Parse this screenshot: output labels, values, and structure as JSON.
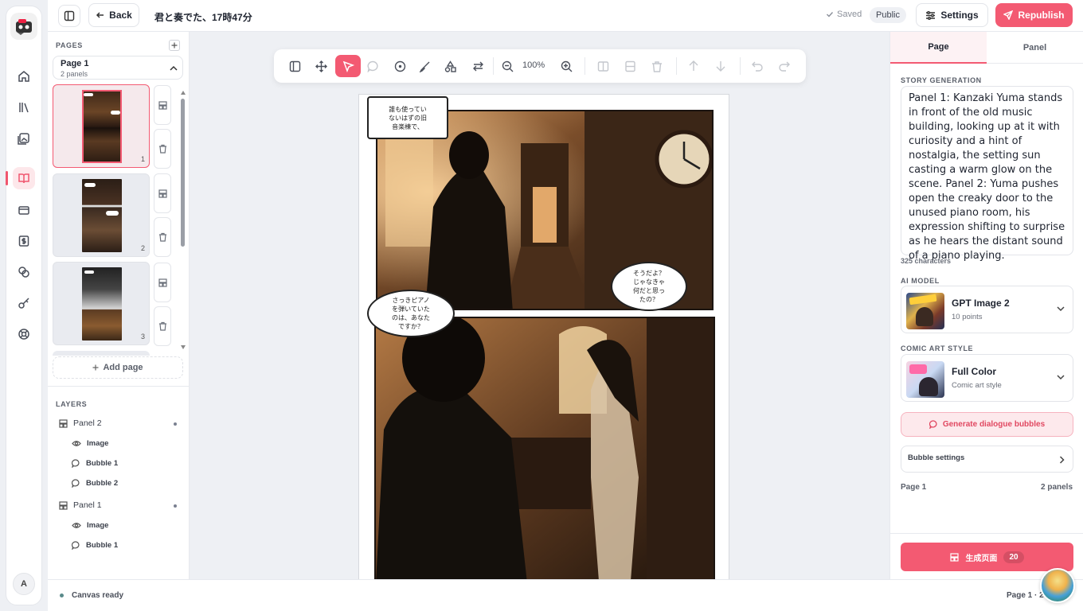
{
  "nav": {
    "items": [
      "home-icon",
      "library-icon",
      "gallery-icon",
      "book-icon",
      "card-icon",
      "dollar-icon",
      "coins-icon",
      "key-icon",
      "help-icon"
    ],
    "active_index": 3,
    "avatar_initial": "A"
  },
  "topbar": {
    "back_label": "Back",
    "doc_title": "君と奏でた、17時47分",
    "saved_label": "Saved",
    "visibility": "Public",
    "settings_label": "Settings",
    "republish_label": "Republish"
  },
  "pages_panel": {
    "heading": "PAGES",
    "current_page": "Page 1",
    "current_page_sub": "2 panels",
    "thumbs": [
      {
        "num": "1"
      },
      {
        "num": "2"
      },
      {
        "num": "3"
      }
    ],
    "add_page_label": "Add page"
  },
  "layers": {
    "heading": "LAYERS",
    "panel2": "Panel 2",
    "panel2_children": [
      "Image",
      "Bubble 1",
      "Bubble 2"
    ],
    "panel1": "Panel 1",
    "panel1_children": [
      "Image",
      "Bubble 1"
    ]
  },
  "toolbar": {
    "zoom": "100%"
  },
  "canvas": {
    "bubble1": "誰も使ってい\nないはずの旧\n音楽棟で、",
    "bubble2": "そうだよ？\nじゃなきゃ\n何だと思っ\nたの？",
    "bubble3": "さっきピアノ\nを弾いていた\nのは、あなた\nですか？"
  },
  "status": {
    "left": "Canvas ready",
    "right": "Page 1 · 2"
  },
  "right_panel": {
    "tab_page": "Page",
    "tab_panel": "Panel",
    "story_heading": "STORY GENERATION",
    "story_text": "Panel 1: Kanzaki Yuma stands in front of the old music building, looking up at it with curiosity and a hint of nostalgia, the setting sun casting a warm glow on the scene. Panel 2: Yuma pushes open the creaky door to the unused piano room, his expression shifting to surprise as he hears the distant sound of a piano playing.",
    "char_count": "325 characters",
    "model_heading": "AI MODEL",
    "model_name": "GPT Image 2",
    "model_points": "10 points",
    "style_heading": "COMIC ART STYLE",
    "style_name": "Full Color",
    "style_sub": "Comic art style",
    "gen_bubbles_label": "Generate dialogue bubbles",
    "bubble_settings_label": "Bubble settings",
    "footer_left": "Page 1",
    "footer_right": "2 panels",
    "gen_page_label": "生成页面",
    "gen_page_cost": "20"
  },
  "colors": {
    "accent": "#f35a72",
    "accent_soft": "#fde9ec"
  }
}
